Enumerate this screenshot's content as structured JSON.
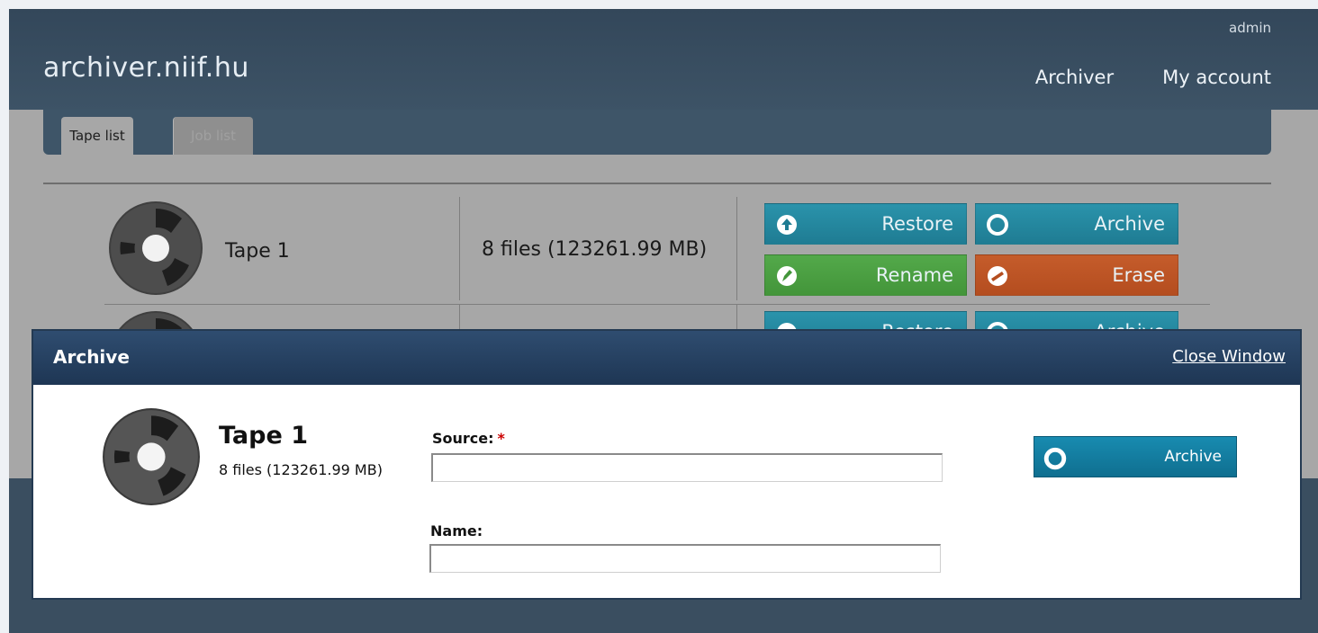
{
  "header": {
    "brand": "archiver.niif.hu",
    "user": "admin",
    "nav": [
      "Archiver",
      "My account"
    ]
  },
  "tabs": [
    "Tape list",
    "Job list"
  ],
  "tapes": [
    {
      "name": "Tape 1",
      "info": "8 files (123261.99 MB)",
      "buttons": {
        "restore": "Restore",
        "archive": "Archive",
        "rename": "Rename",
        "erase": "Erase"
      }
    }
  ],
  "row2_buttons": {
    "restore": "Restore",
    "archive": "Archive"
  },
  "modal": {
    "title": "Archive",
    "close": "Close Window",
    "tape_name": "Tape 1",
    "tape_info": "8 files (123261.99 MB)",
    "source_label": "Source:",
    "required_mark": "*",
    "source_value": "",
    "name_label": "Name:",
    "name_value": "",
    "archive_button": "Archive"
  },
  "colors": {
    "header_bg": "#33475a",
    "content_bg": "#a7a7a7",
    "btn_blue": "#2a93ab",
    "btn_green": "#53a94a",
    "btn_orange": "#c55c2b",
    "modal_head": "#2f4d70"
  },
  "icons": {
    "reel": "tape-reel-icon",
    "restore": "up-arrow-circle-icon",
    "archive": "ring-icon",
    "rename": "pencil-icon",
    "erase": "minus-circle-icon"
  }
}
